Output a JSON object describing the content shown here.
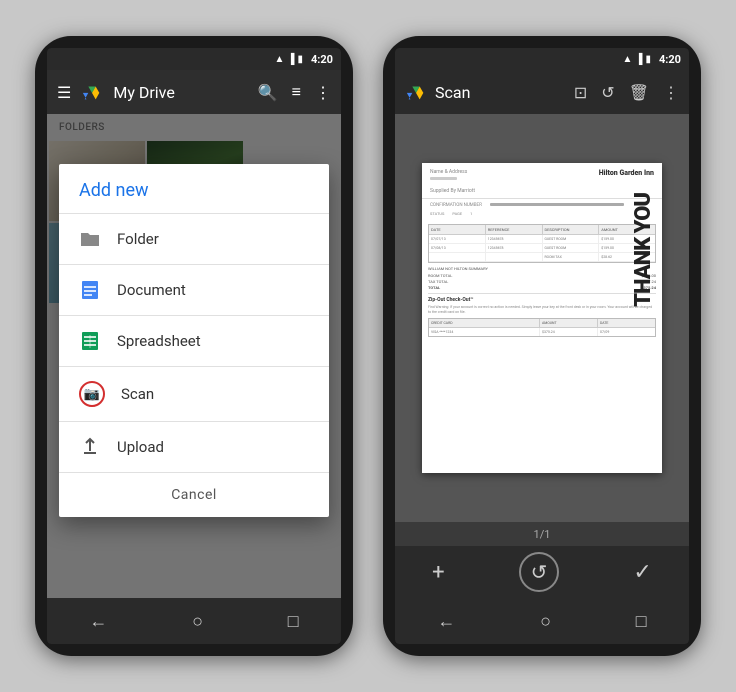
{
  "phone1": {
    "statusBar": {
      "wifi": "📶",
      "signal": "📶",
      "time": "4:20"
    },
    "toolbar": {
      "title": "My Drive",
      "searchIcon": "🔍",
      "listIcon": "☰",
      "moreIcon": "⋮"
    },
    "foldersLabel": "FOLDERS",
    "modal": {
      "title": "Add new",
      "items": [
        {
          "id": "folder",
          "label": "Folder",
          "icon": "folder"
        },
        {
          "id": "document",
          "label": "Document",
          "icon": "doc"
        },
        {
          "id": "spreadsheet",
          "label": "Spreadsheet",
          "icon": "sheet"
        },
        {
          "id": "scan",
          "label": "Scan",
          "icon": "scan"
        },
        {
          "id": "upload",
          "label": "Upload",
          "icon": "upload"
        }
      ],
      "cancelLabel": "Cancel"
    },
    "navButtons": [
      "←",
      "○",
      "□"
    ]
  },
  "phone2": {
    "statusBar": {
      "time": "4:20"
    },
    "toolbar": {
      "title": "Scan",
      "cropIcon": "⊡",
      "rotateIcon": "⟳",
      "deleteIcon": "🗑",
      "moreIcon": "⋮"
    },
    "pageCounter": "1/1",
    "actionBar": {
      "addIcon": "+",
      "retakeIcon": "↺",
      "checkIcon": "✓"
    },
    "document": {
      "hotelName": "Hilton\nGarden Inn",
      "thankYou": "THANK\nYOU"
    }
  }
}
